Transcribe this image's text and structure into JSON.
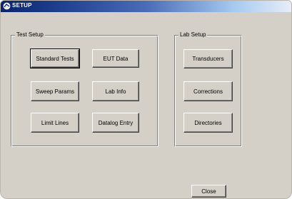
{
  "window": {
    "title": "SETUP",
    "icon": "app-icon"
  },
  "test_setup": {
    "legend": "Test Setup",
    "buttons": {
      "standard_tests": "Standard Tests",
      "eut_data": "EUT Data",
      "sweep_params": "Sweep Params",
      "lab_info": "Lab Info",
      "limit_lines": "Limit Lines",
      "datalog_entry": "Datalog Entry"
    }
  },
  "lab_setup": {
    "legend": "Lab Setup",
    "buttons": {
      "transducers": "Transducers",
      "corrections": "Corrections",
      "directories": "Directories"
    }
  },
  "footer": {
    "close_label": "Close"
  }
}
